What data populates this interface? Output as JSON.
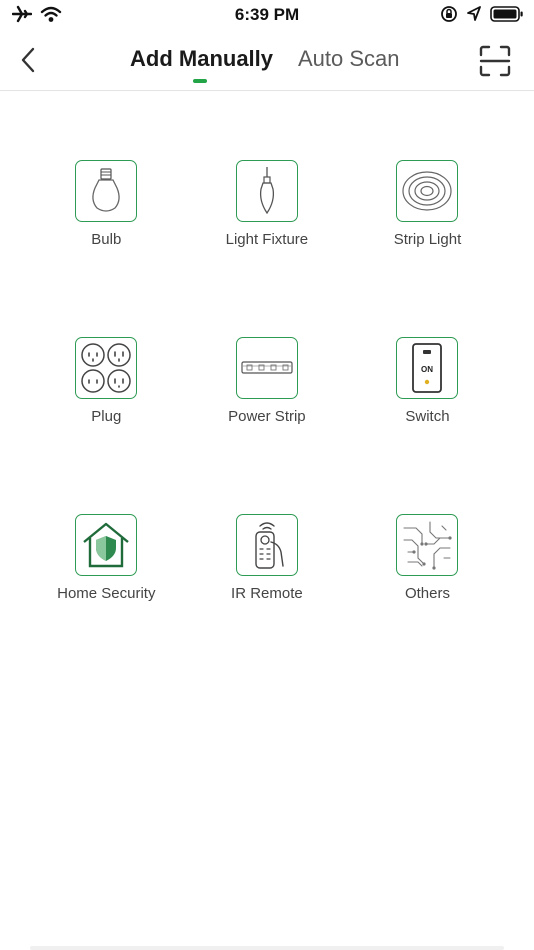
{
  "status_bar": {
    "time": "6:39 PM"
  },
  "header": {
    "tabs": [
      {
        "label": "Add Manually",
        "active": true
      },
      {
        "label": "Auto Scan",
        "active": false
      }
    ],
    "accent_color": "#22a447"
  },
  "categories": [
    {
      "label": "Bulb",
      "icon": "bulb-icon"
    },
    {
      "label": "Light Fixture",
      "icon": "light-fixture-icon"
    },
    {
      "label": "Strip Light",
      "icon": "strip-light-icon"
    },
    {
      "label": "Plug",
      "icon": "plug-icon"
    },
    {
      "label": "Power Strip",
      "icon": "power-strip-icon"
    },
    {
      "label": "Switch",
      "icon": "switch-icon",
      "badge": "ON"
    },
    {
      "label": "Home Security",
      "icon": "home-security-icon"
    },
    {
      "label": "IR Remote",
      "icon": "ir-remote-icon"
    },
    {
      "label": "Others",
      "icon": "others-icon"
    }
  ]
}
